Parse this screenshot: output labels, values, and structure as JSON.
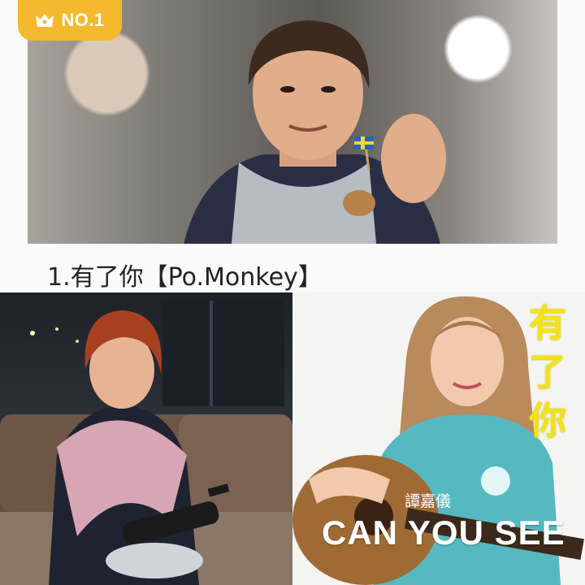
{
  "badge": {
    "icon": "crown-icon",
    "label": "NO.1",
    "color": "#f5b92f"
  },
  "caption": "1.有了你【Po.Monkey】",
  "album": {
    "title_chars": [
      "有",
      "了",
      "你"
    ],
    "artist": "譚嘉儀",
    "cover_text": "CAN YOU SEE",
    "title_color": "#f3e21a"
  }
}
